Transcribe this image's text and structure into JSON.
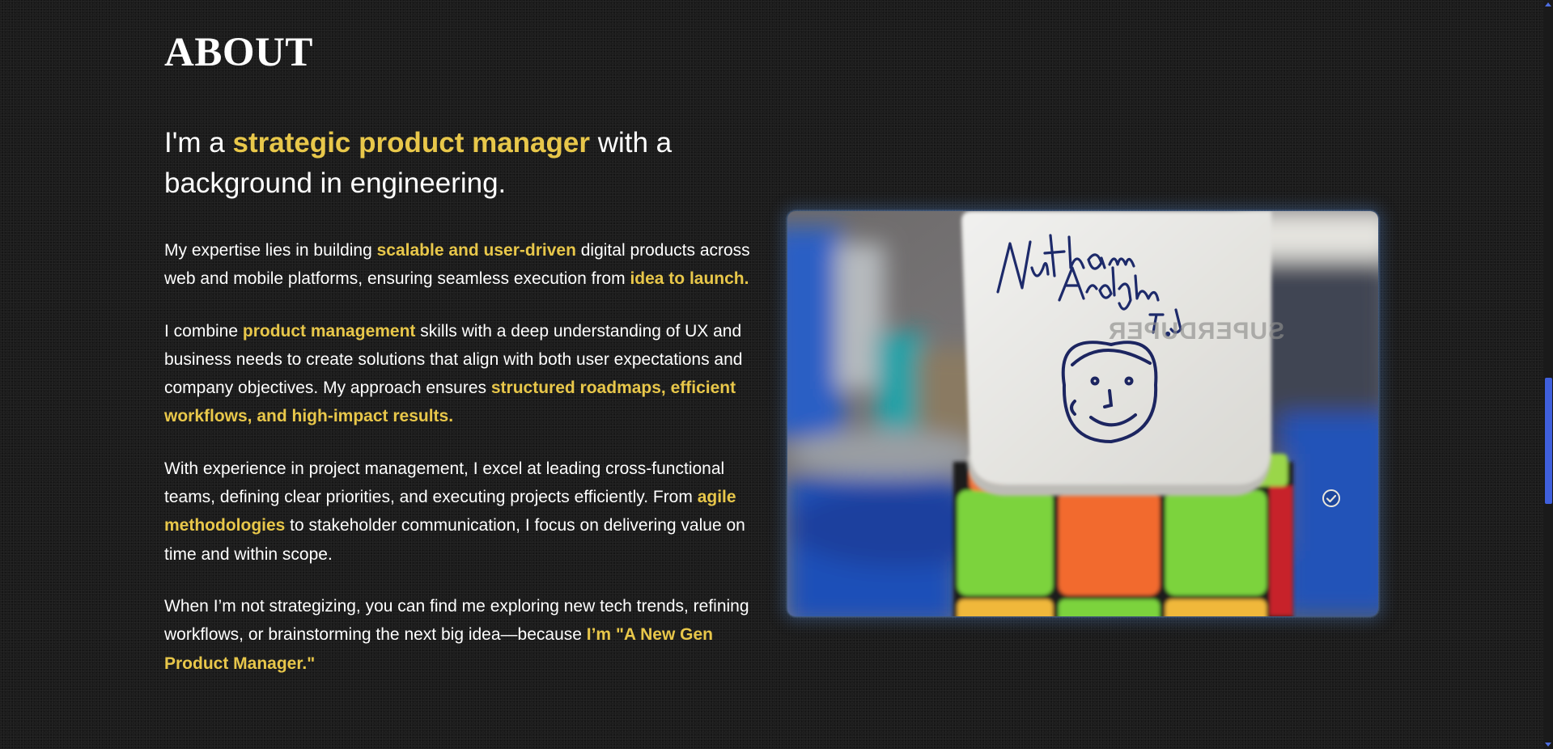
{
  "about": {
    "title": "ABOUT",
    "lead": {
      "before": "I'm a ",
      "highlight": "strategic product manager",
      "after": " with a background in engineering."
    },
    "paragraphs": [
      {
        "t1": "My expertise lies in building ",
        "h1": "scalable and user-driven",
        "t2": " digital products across web and mobile platforms, ensuring seamless execution from ",
        "h2": "idea to launch."
      },
      {
        "t1": "I combine ",
        "h1": "product management",
        "t2": " skills with a deep understanding of UX and business needs to create solutions that align with both user expectations and company objectives. My approach ensures ",
        "h2": "structured roadmaps, efficient workflows, and high-impact results."
      },
      {
        "t1": "With experience in project management, I excel at leading cross-functional teams, defining clear priorities, and executing projects efficiently. From ",
        "h1": "agile methodologies",
        "t2": " to stakeholder communication, I focus on delivering value on time and within scope."
      },
      {
        "t1": "When I’m not strategizing, you can find me exploring new tech trends, refining workflows, or brainstorming the next big idea—because ",
        "h1": "I’m \"A New Gen Product Manager.\""
      }
    ],
    "photo": {
      "icon": "check-circle-icon",
      "handwriting": "Nutham Aradhya T.J",
      "mirrored_text": "SUPERDUPER"
    }
  },
  "scrollbar": {
    "scroll_fraction": 0.61
  },
  "colors": {
    "background": "#1c1c1c",
    "text": "#ffffff",
    "accent": "#e8c74a",
    "scroll_thumb": "#3f5fdc"
  }
}
